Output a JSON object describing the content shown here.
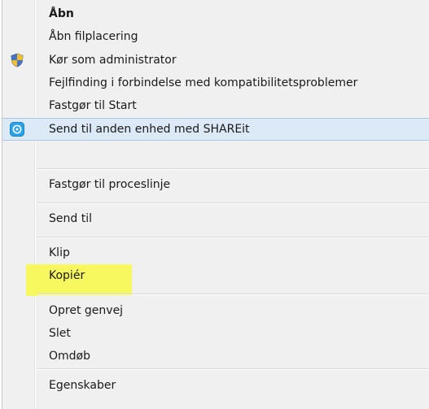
{
  "context_menu": {
    "items": [
      {
        "label": "Åbn",
        "icon": null
      },
      {
        "label": "Åbn filplacering",
        "icon": null
      },
      {
        "label": "Kør som administrator",
        "icon": "uac-shield-icon"
      },
      {
        "label": "Fejlfinding i forbindelse med kompatibilitetsproblemer",
        "icon": null
      },
      {
        "label": "Fastgør til Start",
        "icon": null
      },
      {
        "label": "Send til anden enhed med SHAREit",
        "icon": "shareit-icon"
      },
      {
        "label": "Fastgør til proceslinje",
        "icon": null
      },
      {
        "label": "Send til",
        "icon": null
      },
      {
        "label": "Klip",
        "icon": null
      },
      {
        "label": "Kopiér",
        "icon": null
      },
      {
        "label": "Opret genvej",
        "icon": null
      },
      {
        "label": "Slet",
        "icon": null
      },
      {
        "label": "Omdøb",
        "icon": null
      },
      {
        "label": "Egenskaber",
        "icon": null
      }
    ],
    "default_item": "Åbn",
    "hovered_item": "Send til anden enhed med SHAREit",
    "highlighted_item": "Kopiér"
  },
  "colors": {
    "menu_background": "#f0f0f0",
    "hover_background": "#dce9f7",
    "hover_border": "#a7c6e8",
    "highlight_marker": "#f7f760",
    "text": "#1a1a1a"
  }
}
